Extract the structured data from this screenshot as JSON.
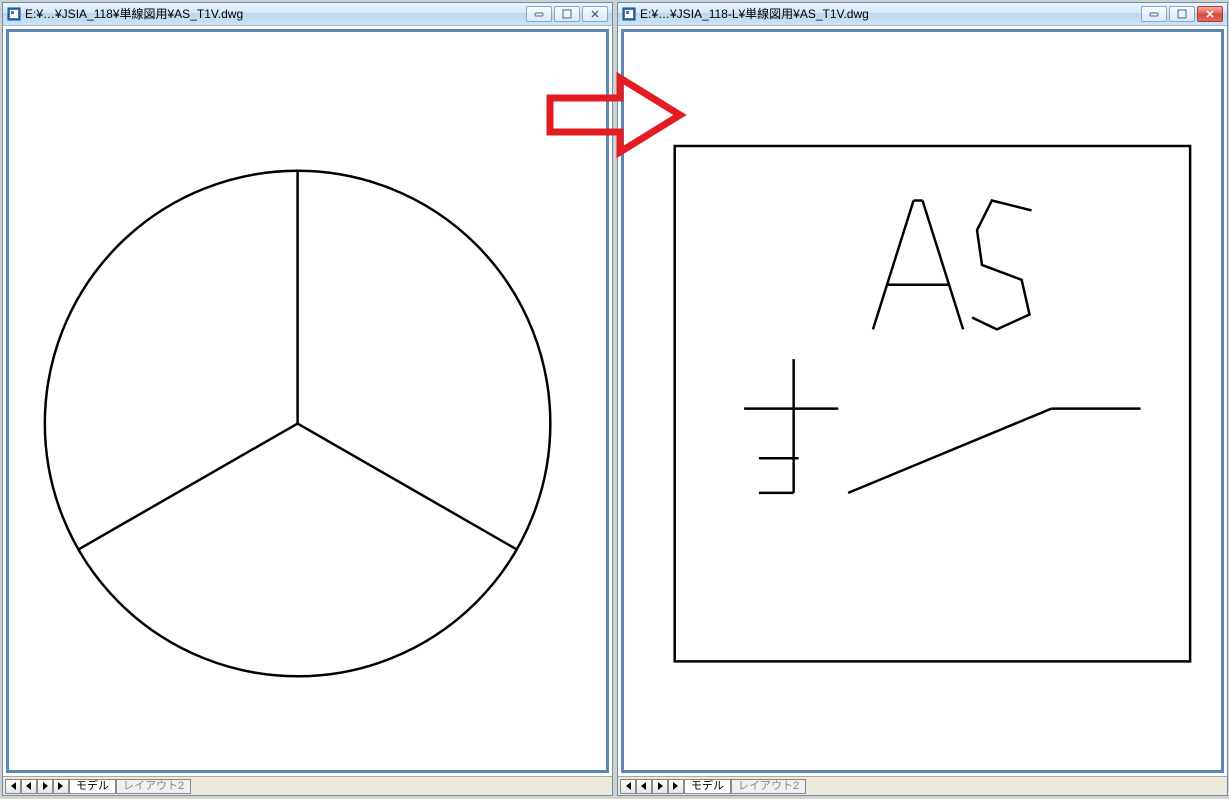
{
  "left_window": {
    "title": "E:¥…¥JSIA_118¥単線図用¥AS_T1V.dwg",
    "tabs": {
      "model": "モデル",
      "layout": "レイアウト2"
    }
  },
  "right_window": {
    "title": "E:¥…¥JSIA_118-L¥単線図用¥AS_T1V.dwg",
    "tabs": {
      "model": "モデル",
      "layout": "レイアウト2"
    }
  },
  "drawing": {
    "left_label": "",
    "right_text": "AS"
  },
  "colors": {
    "arrow": "#e31b23",
    "titlebar_border": "#6090c0"
  }
}
